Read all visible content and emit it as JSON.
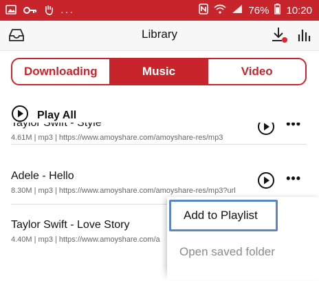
{
  "status_bar": {
    "battery": "76%",
    "time": "10:20",
    "overflow": "···"
  },
  "header": {
    "title": "Library"
  },
  "tabs": [
    {
      "label": "Downloading",
      "active": false
    },
    {
      "label": "Music",
      "active": true
    },
    {
      "label": "Video",
      "active": false
    }
  ],
  "play_all": {
    "label": "Play All"
  },
  "tracks": [
    {
      "name": "Taylor Swift - Style",
      "meta": "4.61M | mp3 | https://www.amoyshare.com/amoyshare-res/mp3"
    },
    {
      "name": "Adele - Hello",
      "meta": "8.30M | mp3 | https://www.amoyshare.com/amoyshare-res/mp3?url"
    },
    {
      "name": "Taylor Swift - Love Story",
      "meta": "4.40M | mp3 | https://www.amoyshare.com/a"
    }
  ],
  "context_menu": {
    "items": [
      {
        "label": "Add to Playlist"
      },
      {
        "label": "Open saved folder"
      }
    ]
  },
  "colors": {
    "brand": "#c8242b",
    "highlight": "#5b86c5"
  }
}
